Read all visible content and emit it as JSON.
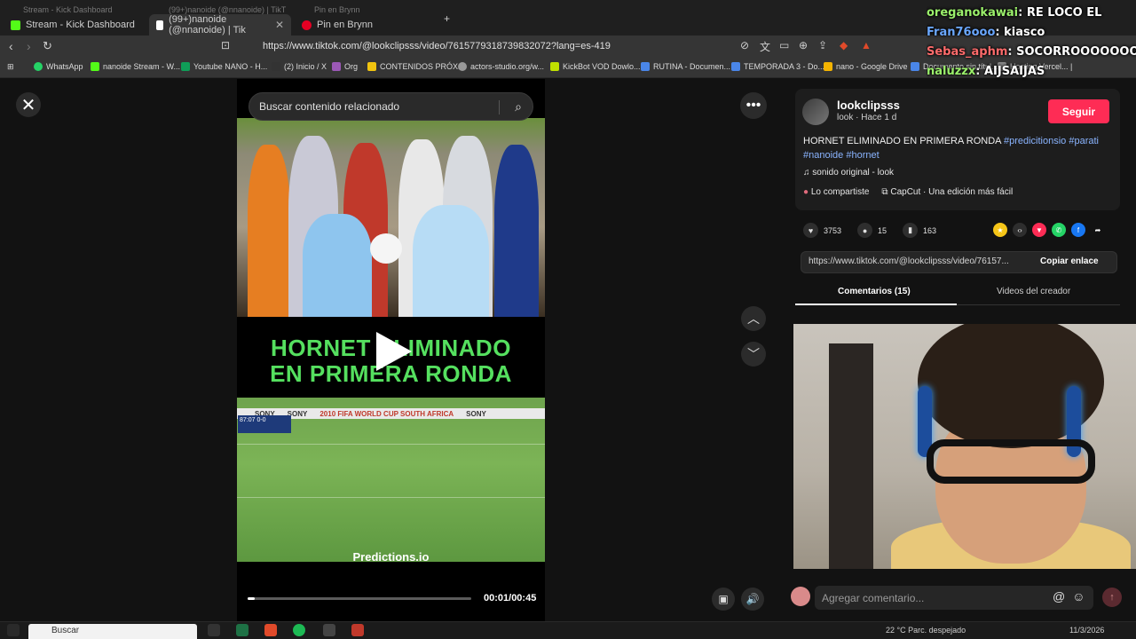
{
  "browser": {
    "tabs": [
      {
        "label": "Stream - Kick Dashboard",
        "color": "#53fc18"
      },
      {
        "label": "(99+)nanoide (@nnanoide) | Tik",
        "color": "#ffffff"
      },
      {
        "label": "Pin en Brynn",
        "color": "#e60023"
      }
    ],
    "ghost_tabs": [
      "Stream - Kick Dashboard",
      "(99+)nanoide (@nnanoide) | TikT",
      "Pin en Brynn"
    ],
    "url": "https://www.tiktok.com/@lookclipsss/video/7615779318739832072?lang=es-419",
    "bookmarks": [
      {
        "label": "WhatsApp",
        "color": "#25d366"
      },
      {
        "label": "nanoide Stream - W...",
        "color": "#53fc18"
      },
      {
        "label": "Youtube NANO - H...",
        "color": "#0f9d58"
      },
      {
        "label": "(2) Inicio / X",
        "color": "#333333"
      },
      {
        "label": "Org",
        "color": "#9b59b6"
      },
      {
        "label": "CONTENIDOS PRÓX...",
        "color": "#f1c40f"
      },
      {
        "label": "actors-studio.org/w...",
        "color": "#999999"
      },
      {
        "label": "KickBot VOD Dowlo...",
        "color": "#c0e000"
      },
      {
        "label": "RUTINA - Documen...",
        "color": "#4a86e8"
      },
      {
        "label": "TEMPORADA 3 - Do...",
        "color": "#4a86e8"
      },
      {
        "label": "nano - Google Drive",
        "color": "#f4b400"
      },
      {
        "label": "Documento sin títul...",
        "color": "#4a86e8"
      },
      {
        "label": "Hosting Vercel... |",
        "color": "#888888"
      }
    ]
  },
  "search": {
    "placeholder": "Buscar contenido relacionado"
  },
  "video": {
    "headline_line1": "HORNET ELIMINADO",
    "headline_line2": "EN PRIMERA RONDA",
    "banner": [
      "SONY",
      "SONY",
      "2010 FIFA WORLD CUP SOUTH AFRICA",
      "SONY"
    ],
    "scoreboard": "87:07 0-0",
    "brand": "Predictions.io",
    "time": "00:01/00:45",
    "progress": 0.03
  },
  "post": {
    "username": "lookclipsss",
    "meta": "look · Hace 1 d",
    "follow": "Seguir",
    "desc_text": "HORNET ELIMINADO EN PRIMERA RONDA ",
    "tags": [
      "#predicitionsio",
      "#parati",
      "#nanoide",
      "#hornet"
    ],
    "music": "sonido original - look",
    "shared": "Lo compartiste",
    "capcut": "CapCut · Una edición más fácil",
    "likes": "3753",
    "comments": "15",
    "saves": "163",
    "link": "https://www.tiktok.com/@lookclipsss/video/76157...",
    "copy": "Copiar enlace",
    "tab_comments": "Comentarios (15)",
    "tab_videos": "Videos del creador"
  },
  "comment_input": {
    "placeholder": "Agregar comentario..."
  },
  "chat": [
    {
      "user": "oreganokawai",
      "msg": "RE LOCO EL",
      "color": "#9bf06b"
    },
    {
      "user": "Fran76ooo",
      "msg": "kiasco",
      "color": "#6aa7ff"
    },
    {
      "user": "Sebas_aphm",
      "msg": "SOCORROOOOOOO",
      "color": "#ff6b6b"
    },
    {
      "user": "naluzzx",
      "msg": "AIJSAIJAS",
      "color": "#9bf06b"
    }
  ],
  "taskbar": {
    "search": "Buscar",
    "weather": "22 °C  Parc. despejado",
    "date": "11/3/2026"
  },
  "icons": [
    "close-icon",
    "search-icon",
    "more-icon",
    "chevron-up-icon",
    "chevron-down-icon",
    "play-icon",
    "volume-icon",
    "heart-icon",
    "comment-icon",
    "bookmark-icon",
    "share-icon",
    "music-icon",
    "send-icon",
    "emoji-icon",
    "mention-icon"
  ]
}
